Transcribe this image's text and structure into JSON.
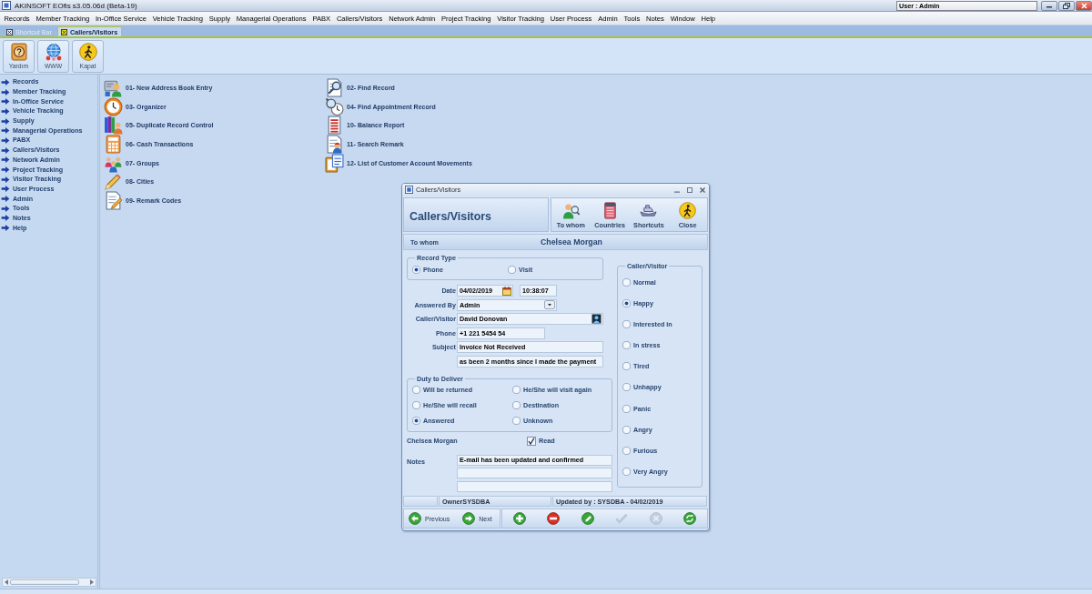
{
  "app": {
    "title": "AKINSOFT EOfis s3.05.06d (Beta-19)",
    "user": "User : Admin"
  },
  "menu": [
    "Records",
    "Member Tracking",
    "In-Office Service",
    "Vehicle Tracking",
    "Supply",
    "Managerial Operations",
    "PABX",
    "Callers/Visitors",
    "Network Admin",
    "Project Tracking",
    "Visitor Tracking",
    "User Process",
    "Admin",
    "Tools",
    "Notes",
    "Window",
    "Help"
  ],
  "tabs": [
    {
      "label": "Shortcut Bar",
      "selected": false
    },
    {
      "label": "Callers/Visitors",
      "selected": true
    }
  ],
  "toolbar": [
    {
      "label": "Yardım",
      "kind": "help"
    },
    {
      "label": "WWW",
      "kind": "web"
    },
    {
      "label": "Kapat",
      "kind": "exit"
    }
  ],
  "sidebar": {
    "items": [
      "Records",
      "Member Tracking",
      "In-Office Service",
      "Vehicle Tracking",
      "Supply",
      "Managerial Operations",
      "PABX",
      "Callers/Visitors",
      "Network Admin",
      "Project Tracking",
      "Visitor Tracking",
      "User Process",
      "Admin",
      "Tools",
      "Notes",
      "Help"
    ]
  },
  "shortcuts": {
    "columns": [
      [
        {
          "label": "01- New Address Book Entry",
          "kind": "address"
        },
        {
          "label": "03- Organizer",
          "kind": "organizer"
        },
        {
          "label": "05- Duplicate Record Control",
          "kind": "duplicate"
        },
        {
          "label": "06- Cash Transactions",
          "kind": "cash"
        },
        {
          "label": "07- Groups",
          "kind": "groups"
        },
        {
          "label": "08- Cities",
          "kind": "cities"
        },
        {
          "label": "09- Remark Codes",
          "kind": "remarks"
        }
      ],
      [
        {
          "label": "02- Find Record",
          "kind": "find"
        },
        {
          "label": "04- Find Appointment Record",
          "kind": "appointment"
        },
        {
          "label": "10- Balance Report",
          "kind": "balance"
        },
        {
          "label": "11- Search Remark",
          "kind": "search_remark"
        },
        {
          "label": "12- List of Customer Account Movements",
          "kind": "movements"
        }
      ]
    ]
  },
  "dialog": {
    "window_title": "Callers/Visitors",
    "heading": "Callers/Visitors",
    "toolbar": [
      {
        "label": "To whom",
        "kind": "person_search"
      },
      {
        "label": "Countries",
        "kind": "book"
      },
      {
        "label": "Shortcuts",
        "kind": "boat"
      },
      {
        "label": "Close",
        "kind": "exit"
      }
    ],
    "to_whom": {
      "label": "To whom",
      "value": "Chelsea Morgan"
    },
    "record_type": {
      "title": "Record Type",
      "options": [
        {
          "label": "Phone",
          "selected": true
        },
        {
          "label": "Visit",
          "selected": false
        }
      ]
    },
    "date": {
      "label": "Date",
      "value": "04/02/2019",
      "time": "10:38:07"
    },
    "answered_by": {
      "label": "Answered By",
      "value": "Admin"
    },
    "caller_visitor": {
      "label": "Caller/Visitor",
      "value": "David Donovan"
    },
    "phone": {
      "label": "Phone",
      "value": "+1 221 5454 54"
    },
    "subject": {
      "label": "Subject",
      "value": "Invoice Not Received",
      "more": "as been 2 months since I made the payment"
    },
    "duty": {
      "title": "Duty to Deliver",
      "options": [
        {
          "label": "Will be returned",
          "selected": false
        },
        {
          "label": "He/She will visit again",
          "selected": false
        },
        {
          "label": "He/She will recall",
          "selected": false
        },
        {
          "label": "Destination",
          "selected": false
        },
        {
          "label": "Answered",
          "selected": true
        },
        {
          "label": "Unknown",
          "selected": false
        }
      ]
    },
    "recipient": "Chelsea Morgan",
    "read": {
      "label": "Read",
      "checked": true
    },
    "notes": {
      "label": "Notes",
      "lines": [
        "E-mail has been updated and confirmed"
      ]
    },
    "mood": {
      "title": "Caller/Visitor",
      "options": [
        {
          "label": "Normal",
          "selected": false
        },
        {
          "label": "Happy",
          "selected": true
        },
        {
          "label": "Interested in",
          "selected": false
        },
        {
          "label": "In stress",
          "selected": false
        },
        {
          "label": "Tired",
          "selected": false
        },
        {
          "label": "Unhappy",
          "selected": false
        },
        {
          "label": "Panic",
          "selected": false
        },
        {
          "label": "Angry",
          "selected": false
        },
        {
          "label": "Furious",
          "selected": false
        },
        {
          "label": "Very Angry",
          "selected": false
        }
      ]
    },
    "owner": "OwnerSYSDBA",
    "updated": "Updated by : SYSDBA - 04/02/2019",
    "nav": [
      {
        "label": "Previous",
        "kind": "prev"
      },
      {
        "label": "Next",
        "kind": "next"
      }
    ],
    "actions": [
      {
        "kind": "add",
        "disabled": false
      },
      {
        "kind": "delete",
        "disabled": false
      },
      {
        "kind": "edit",
        "disabled": false
      },
      {
        "kind": "save",
        "disabled": true
      },
      {
        "kind": "cancel",
        "disabled": true
      },
      {
        "kind": "refresh",
        "disabled": false
      }
    ]
  }
}
